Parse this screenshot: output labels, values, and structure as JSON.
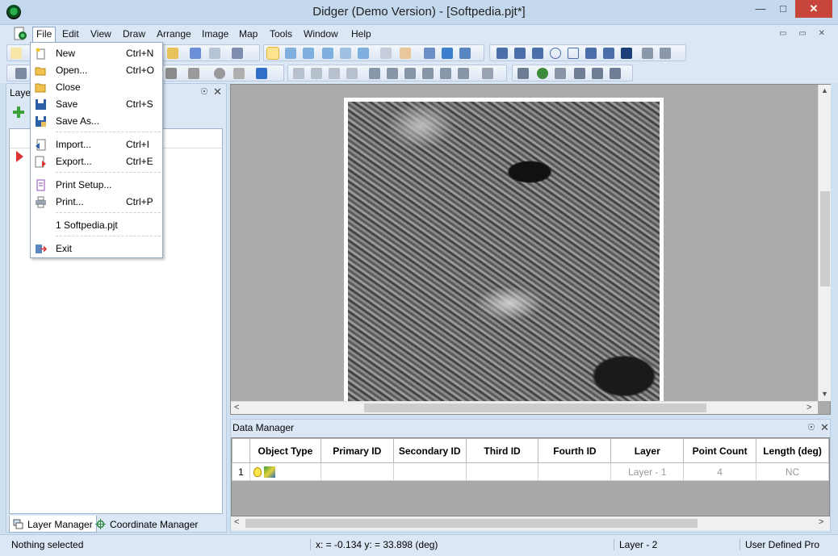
{
  "window": {
    "title": "Didger (Demo Version) - [Softpedia.pjt*]",
    "min_glyph": "—",
    "max_glyph": "□",
    "close_glyph": "✕"
  },
  "menubar": {
    "items": [
      "File",
      "Edit",
      "View",
      "Draw",
      "Arrange",
      "Image",
      "Map",
      "Tools",
      "Window",
      "Help"
    ],
    "active": "File"
  },
  "file_menu": {
    "items": [
      {
        "label": "New",
        "shortcut": "Ctrl+N",
        "icon": "new-document-icon"
      },
      {
        "label": "Open...",
        "shortcut": "Ctrl+O",
        "icon": "open-folder-icon"
      },
      {
        "label": "Close",
        "shortcut": "",
        "icon": "close-folder-icon"
      },
      {
        "label": "Save",
        "shortcut": "Ctrl+S",
        "icon": "save-disk-icon"
      },
      {
        "label": "Save As...",
        "shortcut": "",
        "icon": "save-as-icon"
      },
      {
        "label": "Import...",
        "shortcut": "Ctrl+I",
        "icon": "import-icon"
      },
      {
        "label": "Export...",
        "shortcut": "Ctrl+E",
        "icon": "export-icon"
      },
      {
        "label": "Print Setup...",
        "shortcut": "",
        "icon": "print-setup-icon"
      },
      {
        "label": "Print...",
        "shortcut": "Ctrl+P",
        "icon": "printer-icon"
      },
      {
        "label": "1 Softpedia.pjt",
        "shortcut": "",
        "icon": ""
      },
      {
        "label": "Exit",
        "shortcut": "",
        "icon": "exit-icon"
      }
    ]
  },
  "left_panel": {
    "title": "Layer",
    "tabs": [
      "Layer Manager",
      "Coordinate Manager"
    ]
  },
  "data_manager": {
    "title": "Data Manager",
    "columns": [
      "Object Type",
      "Primary ID",
      "Secondary ID",
      "Third ID",
      "Fourth ID",
      "Layer",
      "Point Count",
      "Length (deg)"
    ],
    "rows": [
      {
        "num": "1",
        "object_type": "",
        "primary_id": "",
        "secondary_id": "",
        "third_id": "",
        "fourth_id": "",
        "layer": "Layer - 1",
        "point_count": "4",
        "length": "NC"
      }
    ]
  },
  "statusbar": {
    "selection": "Nothing selected",
    "coords": "x: = -0.134 y: = 33.898 (deg)",
    "layer": "Layer - 2",
    "projection": "User Defined Pro"
  },
  "colors": {
    "chrome": "#dbe7f5",
    "title_bar": "#c5d9ee",
    "close_button": "#c7453a",
    "selected_tool": "#fde38d"
  }
}
